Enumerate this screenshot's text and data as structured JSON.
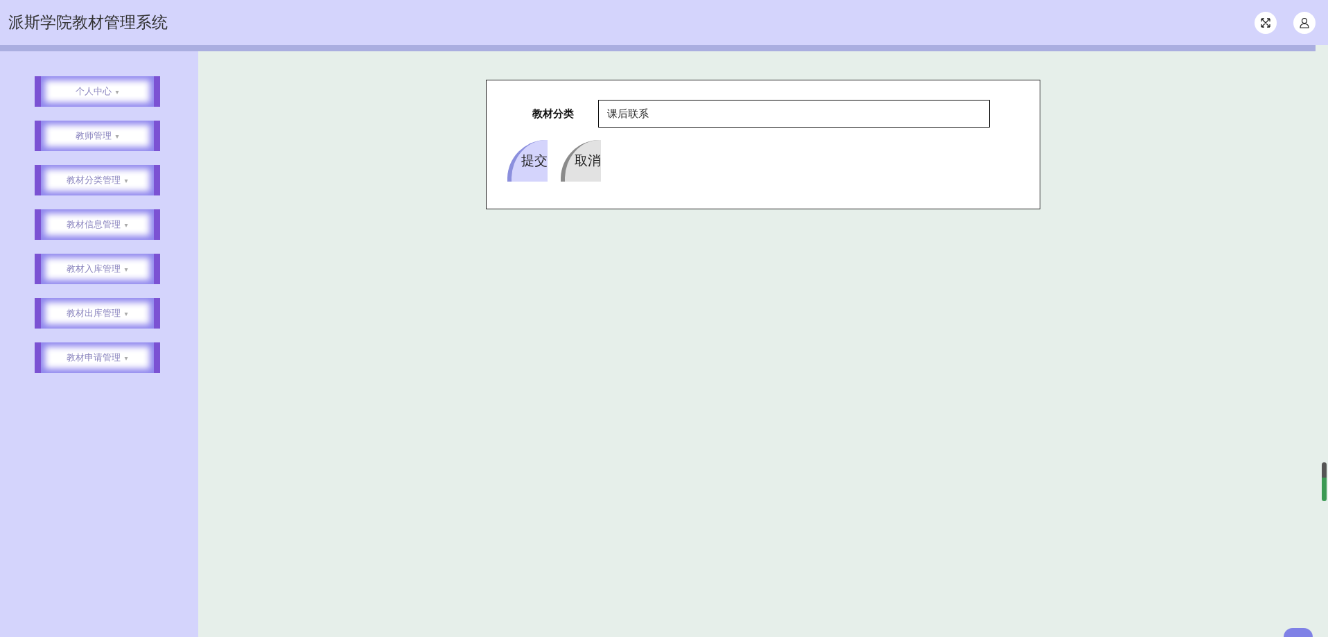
{
  "header": {
    "title": "派斯学院教材管理系统"
  },
  "sidebar": {
    "items": [
      {
        "label": "个人中心",
        "caret": "▾"
      },
      {
        "label": "教师管理",
        "caret": "▾"
      },
      {
        "label": "教材分类管理",
        "caret": "▾"
      },
      {
        "label": "教材信息管理",
        "caret": "▾"
      },
      {
        "label": "教材入库管理",
        "caret": "▾"
      },
      {
        "label": "教材出库管理",
        "caret": "▾"
      },
      {
        "label": "教材申请管理",
        "caret": "▾"
      }
    ]
  },
  "form": {
    "fields": [
      {
        "label": "教材分类",
        "value": "课后联系"
      }
    ],
    "buttons": [
      {
        "kind": "primary",
        "label": "提交"
      },
      {
        "kind": "secondary",
        "label": "取消"
      }
    ]
  }
}
